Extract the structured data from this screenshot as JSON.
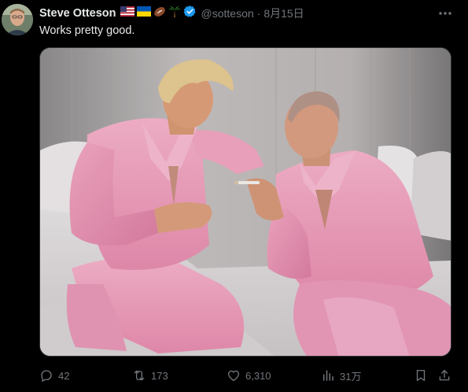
{
  "tweet": {
    "display_name": "Steve Otteson",
    "handle": "@sotteson",
    "separator": "·",
    "date": "8月15日",
    "text": "Works pretty good.",
    "name_emojis": [
      "us-flag-icon",
      "ukraine-flag-icon",
      "football-icon",
      "palm-tree-icon"
    ],
    "verified_color": "#1d9bf0"
  },
  "media": {
    "type": "photo",
    "description_colors": {
      "pajamas": "#f0a5c0",
      "background": "#b9b4b3"
    }
  },
  "actions": {
    "reply_count": "42",
    "retweet_count": "173",
    "like_count": "6,310",
    "views_count": "31万"
  },
  "icons": [
    "more-icon",
    "reply-icon",
    "retweet-icon",
    "like-icon",
    "views-icon",
    "bookmark-icon",
    "share-icon"
  ]
}
